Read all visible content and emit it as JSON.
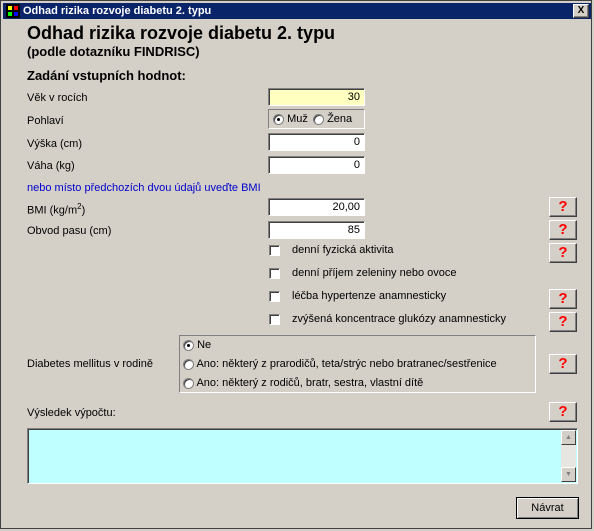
{
  "window": {
    "title": "Odhad rizika rozvoje diabetu 2. typu",
    "close_label": "X",
    "app_icon": "app-icon"
  },
  "header": {
    "title": "Odhad rizika rozvoje diabetu 2. typu",
    "subtitle": "(podle dotazníku FINDRISC)",
    "section": "Zadání vstupních hodnot:"
  },
  "fields": {
    "age_label": "Věk v rocích",
    "age_value": "30",
    "sex_label": "Pohlaví",
    "sex_male": "Muž",
    "sex_female": "Žena",
    "sex_selected": "Muž",
    "height_label": "Výška (cm)",
    "height_value": "0",
    "weight_label": "Váha (kg)",
    "weight_value": "0",
    "bmi_hint": "nebo místo předchozích dvou údajů uveďte BMI",
    "bmi_label": "BMI (kg/m",
    "bmi_sup": "2",
    "bmi_label_end": ")",
    "bmi_value": "20,00",
    "waist_label": "Obvod pasu (cm)",
    "waist_value": "85"
  },
  "checkboxes": [
    {
      "label": "denní fyzická aktivita",
      "checked": false
    },
    {
      "label": "denní příjem zeleniny nebo ovoce",
      "checked": false
    },
    {
      "label": "léčba hypertenze anamnesticky",
      "checked": false
    },
    {
      "label": "zvýšená koncentrace glukózy anamnesticky",
      "checked": false
    }
  ],
  "family": {
    "label": "Diabetes mellitus v rodině",
    "options": [
      "Ne",
      "Ano: některý z prarodičů, teta/strýc nebo bratranec/sestřenice",
      "Ano: některý z rodičů, bratr, sestra, vlastní dítě"
    ],
    "selected": "Ne"
  },
  "result": {
    "label": "Výsledek výpočtu:",
    "value": ""
  },
  "help_label": "?",
  "back_button": "Návrat"
}
